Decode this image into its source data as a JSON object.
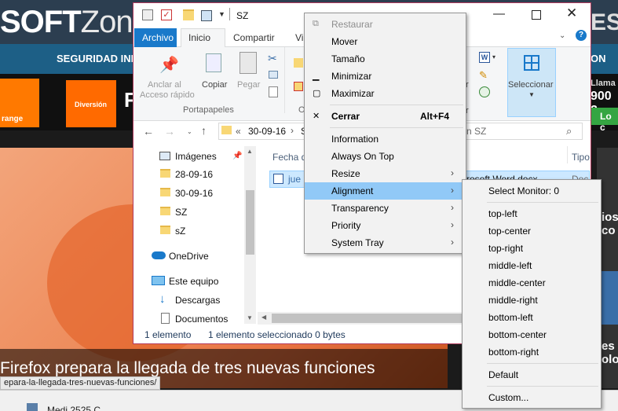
{
  "background_site": {
    "logo_left": "SOFT",
    "logo_right": "Zon",
    "logo_edge": "ES",
    "nav_text": "SEGURIDAD INFORM",
    "nav_right": "ON",
    "ad_orange": "range",
    "ad_diversion": "Diversión",
    "ad_letter": "F",
    "ad_llama": "Llama",
    "ad_900": "900 2",
    "ad_lo": "Lo c",
    "feature_title": "Firefox prepara la llegada de tres nuevas funciones",
    "status_url": "epara-la-llegada-tres-nuevas-funciones/",
    "right_side_1": "ios",
    "right_side_2": "co",
    "right_side_3": "es",
    "right_side_4": "olog",
    "taskbar_item": "Medi  2525 C"
  },
  "explorer": {
    "title": "SZ",
    "tabs": {
      "archivo": "Archivo",
      "inicio": "Inicio",
      "compartir": "Compartir",
      "vista": "Vi"
    },
    "ribbon": {
      "anclar_1": "Anclar al",
      "anclar_2": "Acceso rápido",
      "copiar": "Copiar",
      "pegar": "Pegar",
      "portapapeles": "Portapapeles",
      "group_o": "O",
      "seleccionar": "Seleccionar",
      "abrir_edge": "r"
    },
    "address": {
      "prefix": "«",
      "path": "30-09-16",
      "sep": "›",
      "more": "S"
    },
    "search_placeholder": "n SZ",
    "nav_items": [
      "Imágenes",
      "28-09-16",
      "30-09-16",
      "SZ",
      "sZ",
      "OneDrive",
      "Este equipo",
      "Descargas",
      "Documentos"
    ],
    "columns": {
      "fecha": "Fecha d",
      "tipo": "Tipo"
    },
    "file": {
      "name": "jue",
      "type": "rosoft Word docx",
      "trail": "Doc"
    },
    "status": {
      "count": "1 elemento",
      "selected": "1 elemento seleccionado  0 bytes"
    }
  },
  "context_menu": {
    "items": [
      {
        "label": "Restaurar",
        "glyph": "⧉",
        "disabled": true
      },
      {
        "label": "Mover"
      },
      {
        "label": "Tamaño"
      },
      {
        "label": "Minimizar",
        "glyph": "▁"
      },
      {
        "label": "Maximizar",
        "glyph": "▢"
      },
      {
        "label": "Cerrar",
        "glyph": "✕",
        "shortcut": "Alt+F4",
        "bold": true
      },
      {
        "label": "Information"
      },
      {
        "label": "Always On Top"
      },
      {
        "label": "Resize",
        "submenu": true
      },
      {
        "label": "Alignment",
        "submenu": true,
        "highlighted": true
      },
      {
        "label": "Transparency",
        "submenu": true
      },
      {
        "label": "Priority",
        "submenu": true
      },
      {
        "label": "System Tray",
        "submenu": true
      }
    ],
    "arrow": "›"
  },
  "alignment_submenu": {
    "header": "Select Monitor: 0",
    "positions": [
      "top-left",
      "top-center",
      "top-right",
      "middle-left",
      "middle-center",
      "middle-right",
      "bottom-left",
      "bottom-center",
      "bottom-right"
    ],
    "default": "Default",
    "custom": "Custom..."
  },
  "colors": {
    "window_border": "#b23a5d",
    "ribbon_tab_accent": "#1979ca",
    "menu_highlight": "#91c9f7",
    "selection_fill": "#cce8ff"
  }
}
